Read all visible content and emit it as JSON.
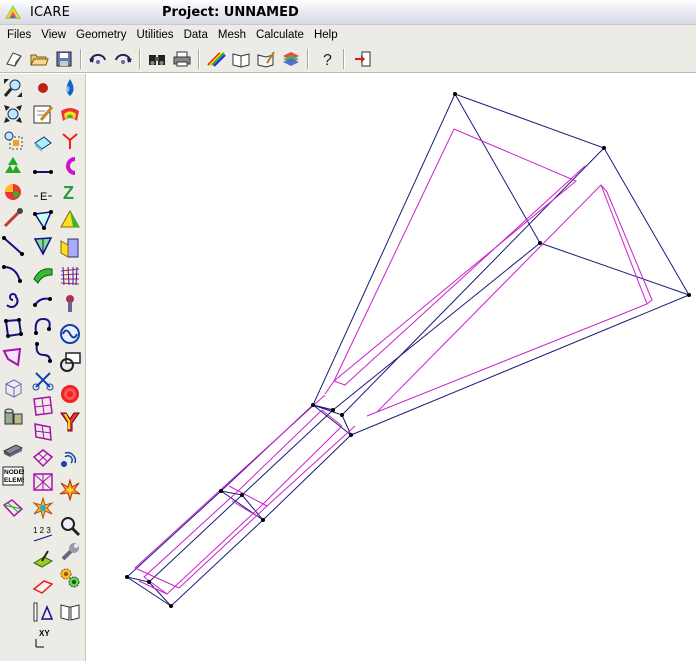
{
  "window": {
    "app_name": "ICARE",
    "project_title": "Project: UNNAMED"
  },
  "menu": [
    "Files",
    "View",
    "Geometry",
    "Utilities",
    "Data",
    "Mesh",
    "Calculate",
    "Help"
  ],
  "toolbar_icons": [
    "new-file-icon",
    "open-folder-icon",
    "save-disk-icon",
    "rotate-left-icon",
    "rotate-right-icon",
    "binoculars-icon",
    "print-icon",
    "rainbow-icon",
    "open-book-icon",
    "edit-book-icon",
    "layers-icon",
    "help-icon",
    "exit-icon"
  ],
  "side_tools": {
    "col1": [
      "zoom-in-icon",
      "zoom-out-icon",
      "zoom-window-icon",
      "recycle-icon",
      "color-sphere-icon",
      "arrow-icon",
      "line-icon",
      "arc-icon",
      "spiral-icon",
      "polygon-icon",
      "surface-icon",
      "cube-icon",
      "cylinder-icon",
      "slab-icon",
      "nodes-elems-icon",
      "mesh-patch-icon"
    ],
    "col2": [
      "point-icon",
      "edit-icon",
      "face-icon",
      "measure-icon",
      "axis-text-icon",
      "node-triangle-icon",
      "triangle-mesh-icon",
      "green-surface-icon",
      "curve-arrow-icon",
      "loop-icon",
      "bent-curve-icon",
      "scissors-icon",
      "grid-patch-icon",
      "warped-grid-icon",
      "warped-mesh-icon",
      "explode-icon",
      "numbering-icon",
      "arrow-plane-icon",
      "red-plane-icon",
      "ruler-triangle-icon",
      "xy-axis-icon"
    ],
    "col3": [
      "drop-icon",
      "colored-surface-icon",
      "axes-icon",
      "magnet-icon",
      "z-letter-icon",
      "prism-icon",
      "section-icon",
      "net-icon",
      "probe-icon",
      "sine-icon",
      "screen-icon",
      "target-icon",
      "y-shape-icon",
      "radar-icon",
      "star-burst-icon",
      "magnifier-icon",
      "wrench-icon",
      "gears-icon",
      "book-icon"
    ]
  },
  "labels": {
    "nodes_elems_icon_text": "NODES ELEMS",
    "axis_text_icon": "E",
    "z_letter": "Z",
    "xy_axis_text": "XY",
    "numbering_text": "1 2 3"
  },
  "colors": {
    "wire_outer": "#1a1a7a",
    "wire_inner": "#cc22cc",
    "node": "#000000",
    "panel": "#ecebe6"
  }
}
